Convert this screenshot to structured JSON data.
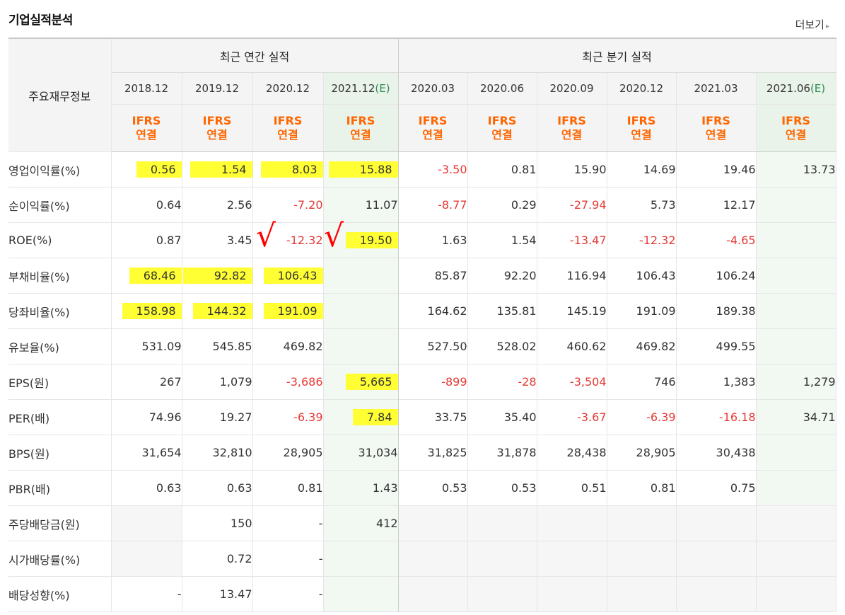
{
  "title": "기업실적분석",
  "more_label": "더보기",
  "more_arrow": "▸",
  "corner_label": "주요재무정보",
  "annual_group": "최근 연간 실적",
  "quarter_group": "최근 분기 실적",
  "periods": [
    {
      "label": "2018.12",
      "est": ""
    },
    {
      "label": "2019.12",
      "est": ""
    },
    {
      "label": "2020.12",
      "est": ""
    },
    {
      "label": "2021.12",
      "est": "(E)"
    },
    {
      "label": "2020.03",
      "est": ""
    },
    {
      "label": "2020.06",
      "est": ""
    },
    {
      "label": "2020.09",
      "est": ""
    },
    {
      "label": "2020.12",
      "est": ""
    },
    {
      "label": "2021.03",
      "est": ""
    },
    {
      "label": "2021.06",
      "est": "(E)"
    }
  ],
  "ifrs_line1": "IFRS",
  "ifrs_line2": "연결",
  "rows": [
    {
      "label": "영업이익률(%)",
      "values": [
        "0.56",
        "1.54",
        "8.03",
        "15.88",
        "-3.50",
        "0.81",
        "15.90",
        "14.69",
        "19.46",
        "13.73"
      ]
    },
    {
      "label": "순이익률(%)",
      "values": [
        "0.64",
        "2.56",
        "-7.20",
        "11.07",
        "-8.77",
        "0.29",
        "-27.94",
        "5.73",
        "12.17",
        ""
      ]
    },
    {
      "label": "ROE(%)",
      "values": [
        "0.87",
        "3.45",
        "-12.32",
        "19.50",
        "1.63",
        "1.54",
        "-13.47",
        "-12.32",
        "-4.65",
        ""
      ]
    },
    {
      "label": "부채비율(%)",
      "values": [
        "68.46",
        "92.82",
        "106.43",
        "",
        "85.87",
        "92.20",
        "116.94",
        "106.43",
        "106.24",
        ""
      ]
    },
    {
      "label": "당좌비율(%)",
      "values": [
        "158.98",
        "144.32",
        "191.09",
        "",
        "164.62",
        "135.81",
        "145.19",
        "191.09",
        "189.38",
        ""
      ]
    },
    {
      "label": "유보율(%)",
      "values": [
        "531.09",
        "545.85",
        "469.82",
        "",
        "527.50",
        "528.02",
        "460.62",
        "469.82",
        "499.55",
        ""
      ]
    },
    {
      "label": "EPS(원)",
      "values": [
        "267",
        "1,079",
        "-3,686",
        "5,665",
        "-899",
        "-28",
        "-3,504",
        "746",
        "1,383",
        "1,279"
      ]
    },
    {
      "label": "PER(배)",
      "values": [
        "74.96",
        "19.27",
        "-6.39",
        "7.84",
        "33.75",
        "35.40",
        "-3.67",
        "-6.39",
        "-16.18",
        "34.71"
      ]
    },
    {
      "label": "BPS(원)",
      "values": [
        "31,654",
        "32,810",
        "28,905",
        "31,034",
        "31,825",
        "31,878",
        "28,438",
        "28,905",
        "30,438",
        ""
      ]
    },
    {
      "label": "PBR(배)",
      "values": [
        "0.63",
        "0.63",
        "0.81",
        "1.43",
        "0.53",
        "0.53",
        "0.51",
        "0.81",
        "0.75",
        ""
      ]
    },
    {
      "label": "주당배당금(원)",
      "values": [
        "",
        "150",
        "-",
        "412",
        "",
        "",
        "",
        "",
        "",
        ""
      ]
    },
    {
      "label": "시가배당률(%)",
      "values": [
        "",
        "0.72",
        "-",
        "",
        "",
        "",
        "",
        "",
        "",
        ""
      ]
    },
    {
      "label": "배당성향(%)",
      "values": [
        "-",
        "13.47",
        "-",
        "",
        "",
        "",
        "",
        "",
        "",
        ""
      ]
    }
  ],
  "check_mark": "√",
  "colors": {
    "ifrs": "#ff6600",
    "negative": "#e53935",
    "estimate": "#2e8b57",
    "highlight": "#ffff33",
    "check": "#ff0000"
  }
}
